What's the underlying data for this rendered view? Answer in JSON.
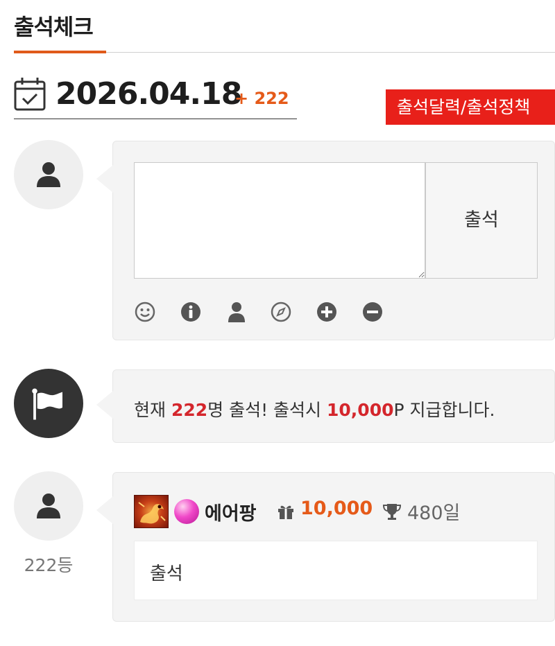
{
  "header": {
    "title": "출석체크",
    "accent_color": "#e05a1a"
  },
  "date_bar": {
    "icon": "calendar-check-icon",
    "date": "2026.04.18",
    "increment": "+ 222",
    "calendar_button_label": "출석달력/출석정책",
    "calendar_button_color": "#e8201a"
  },
  "compose": {
    "avatar_icon": "user-icon",
    "comment_value": "",
    "submit_label": "출석",
    "tools": [
      "smile-icon",
      "info-icon",
      "user-icon",
      "compass-icon",
      "plus-circle-icon",
      "minus-circle-icon"
    ]
  },
  "notice": {
    "icon": "flag-icon",
    "prefix": "현재 ",
    "count": "222",
    "mid": "명 출석! 출석시 ",
    "points": "10,000",
    "suffix": "P 지급합니다.",
    "highlight_color": "#d4262c"
  },
  "entry": {
    "avatar_icon": "user-icon",
    "rank": "222등",
    "level_icon": "dragon-level-icon",
    "orb_icon": "pink-orb-icon",
    "nickname": "에어팡",
    "gift_icon": "gift-icon",
    "points": "10,000",
    "trophy_icon": "trophy-icon",
    "days": "480일",
    "message": "출석"
  }
}
